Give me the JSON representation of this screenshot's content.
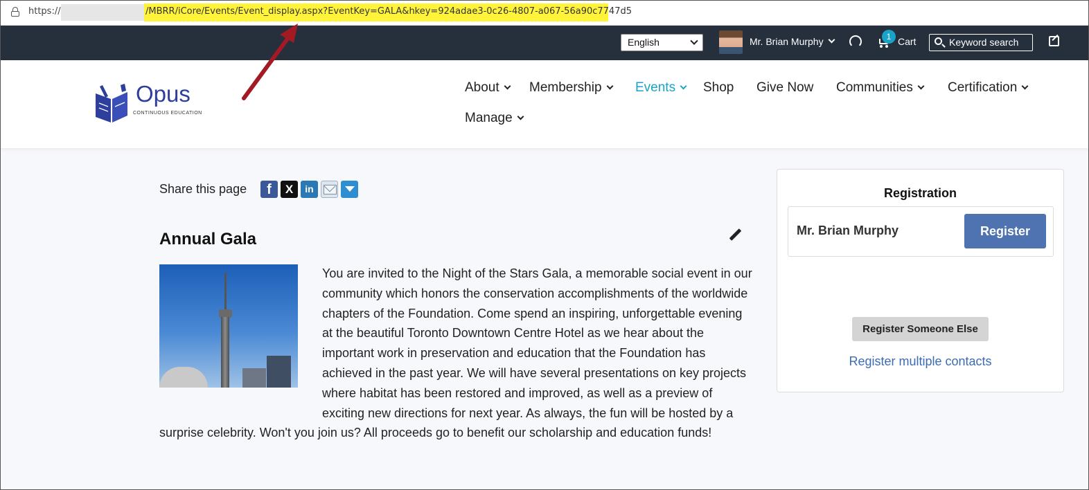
{
  "browser": {
    "url_prefix": "https://",
    "url_path": "/MBRR/iCore/Events/Event_display.aspx?EventKey=GALA&hkey=924adae3-0c26-4807-a067-56a90c7747d5"
  },
  "utility_bar": {
    "language": "English",
    "user_name": "Mr. Brian Murphy",
    "cart_count": "1",
    "cart_label": "Cart",
    "search_label": "Keyword search"
  },
  "logo": {
    "word": "Opus",
    "subtitle": "CONTINUOUS   EDUCATION"
  },
  "nav": {
    "items": [
      {
        "label": "About"
      },
      {
        "label": "Membership"
      },
      {
        "label": "Events"
      },
      {
        "label": "Shop"
      },
      {
        "label": "Give Now"
      },
      {
        "label": "Communities"
      },
      {
        "label": "Certification"
      },
      {
        "label": "Manage"
      }
    ]
  },
  "share": {
    "label": "Share this page",
    "icons": [
      "facebook-icon",
      "x-icon",
      "linkedin-icon",
      "email-icon",
      "more-share-icon"
    ]
  },
  "event": {
    "title": "Annual Gala",
    "description": "You are invited to the Night of the Stars Gala, a memorable social event in our community which honors the conservation accomplishments of the worldwide chapters of the Foundation. Come spend an inspiring, unforgettable evening at the beautiful Toronto Downtown Centre Hotel as we hear about the important work in preservation and education that the Foundation has achieved in the past year. We will have several presentations on key projects where habitat has been restored and improved, as well as a preview of exciting new directions for next year. As always, the fun will be hosted by a surprise celebrity. Won't you join us? All proceeds go to benefit our scholarship and education funds!"
  },
  "registration": {
    "title": "Registration",
    "registrant_name": "Mr. Brian Murphy",
    "register_label": "Register",
    "register_else_label": "Register Someone Else",
    "register_multiple_label": "Register multiple contacts"
  },
  "colors": {
    "topbar": "#262f3c",
    "accent": "#1aa3c8",
    "button_primary": "#4f73b1",
    "link": "#3d6bb3",
    "url_highlight": "#fff43a",
    "annotation_arrow": "#a31a24"
  }
}
